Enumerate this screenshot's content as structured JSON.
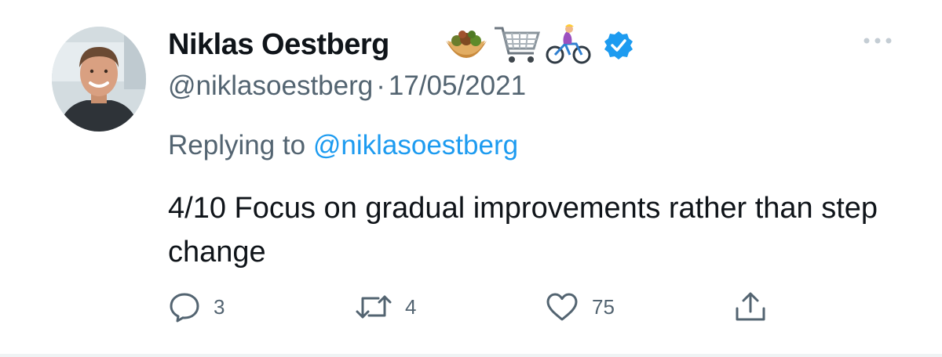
{
  "tweet": {
    "author": {
      "display_name": "Niklas Oestberg",
      "handle": "@niklasoestberg",
      "name_emojis": [
        "falafel-icon",
        "shopping-cart-icon",
        "woman-biking-icon"
      ],
      "verified": true
    },
    "separator": "·",
    "date": "17/05/2021",
    "replying_prefix": "Replying to",
    "replying_to": "@niklasoestberg",
    "text": "4/10 Focus on gradual improvements rather than step change",
    "actions": {
      "replies": "3",
      "retweets": "4",
      "likes": "75"
    }
  },
  "colors": {
    "text": "#0f1419",
    "secondary": "#536471",
    "accent": "#1d9bf0",
    "verified": "#1d9bf0"
  }
}
